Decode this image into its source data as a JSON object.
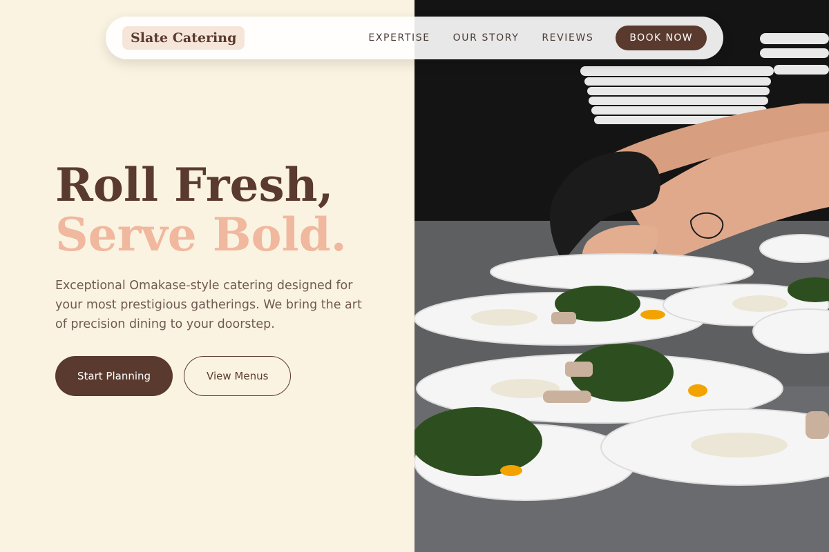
{
  "brand": {
    "name": "Slate Catering"
  },
  "nav": {
    "links": [
      "EXPERTISE",
      "OUR STORY",
      "REVIEWS"
    ],
    "cta": "BOOK NOW"
  },
  "hero": {
    "title_line1": "Roll Fresh,",
    "title_line2": "Serve Bold.",
    "description": "Exceptional Omakase-style catering designed for your most prestigious gatherings. We bring the art of precision dining to your doorstep.",
    "primary_button": "Start Planning",
    "secondary_button": "View Menus"
  },
  "colors": {
    "background": "#FBF3E1",
    "brand_brown": "#5A3A2E",
    "accent_peach": "#F0B89E"
  },
  "image": {
    "icon": "chef-plating-photo"
  }
}
